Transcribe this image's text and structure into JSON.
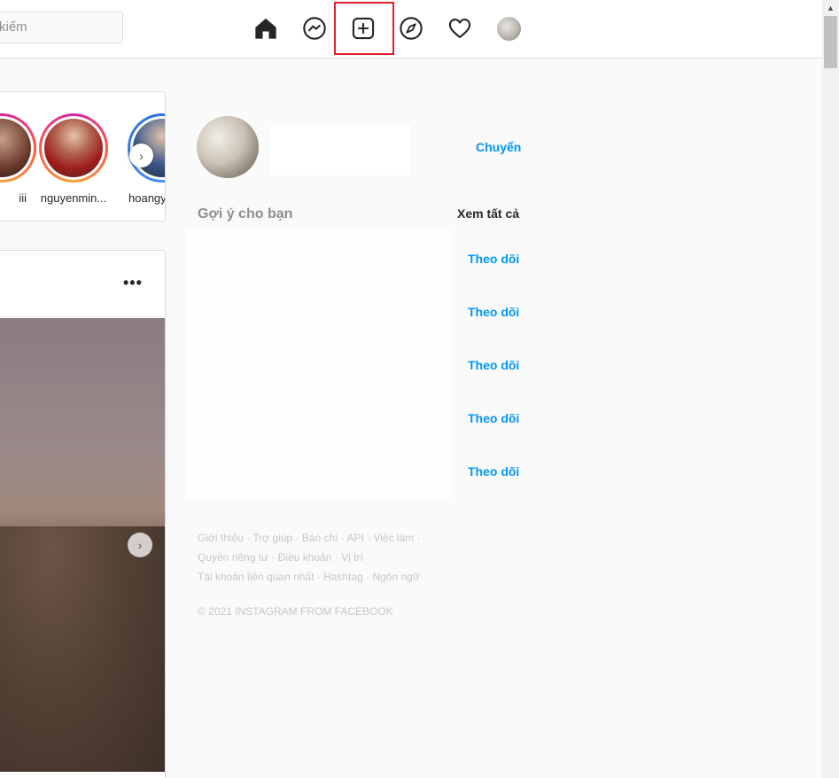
{
  "search": {
    "placeholder": "Tìm kiếm",
    "visible_text": "kiếm"
  },
  "nav": {
    "icons": [
      "home-icon",
      "messenger-icon",
      "new-post-icon",
      "explore-icon",
      "activity-heart-icon",
      "profile-avatar"
    ]
  },
  "stories": {
    "items": [
      {
        "name": "iii"
      },
      {
        "name": "nguyenmin..."
      },
      {
        "name": "hoangy"
      }
    ]
  },
  "sidebar": {
    "switch_label": "Chuyển",
    "suggestions_title": "Gợi ý cho bạn",
    "see_all": "Xem tất cả",
    "follow_label": "Theo dõi"
  },
  "footer": {
    "line1": "Giới thiệu · Trợ giúp · Báo chí · API · Việc làm ·",
    "line2": "Quyền riêng tư · Điều khoản · Vị trí",
    "line3": "Tài khoản liên quan nhất · Hashtag · Ngôn ngữ",
    "copyright": "© 2021 INSTAGRAM FROM FACEBOOK"
  },
  "colors": {
    "accent": "#0095f6",
    "highlight": "#e0202a"
  }
}
